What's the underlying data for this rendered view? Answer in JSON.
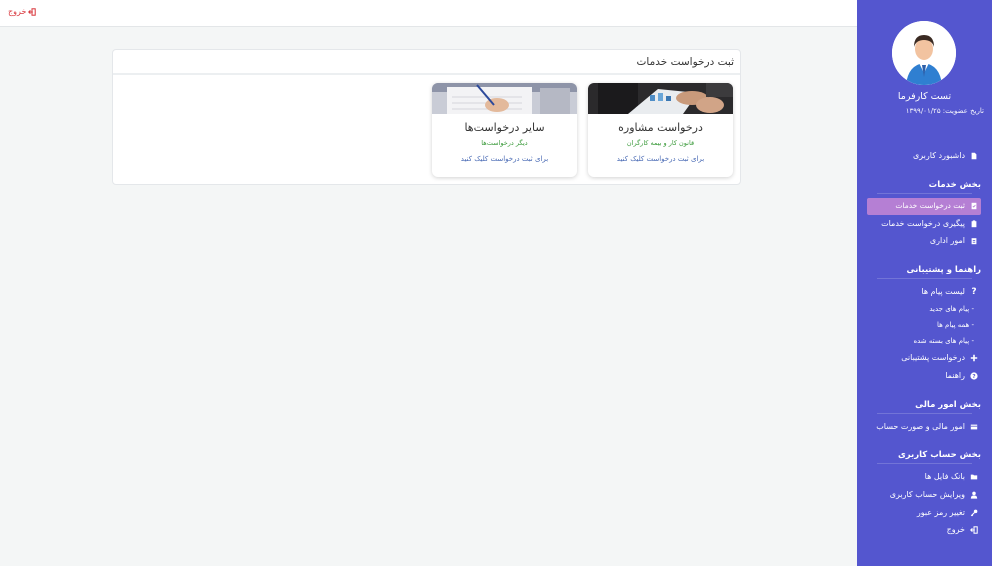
{
  "topbar": {
    "logout_label": "خروج"
  },
  "panel": {
    "title": "ثبت درخواست خدمات",
    "cards": [
      {
        "title": "درخواست مشاوره",
        "subtitle": "قانون کار و بیمه کارگران",
        "link": "برای ثبت درخواست کلیک کنید"
      },
      {
        "title": "سایر درخواست‌ها",
        "subtitle": "دیگر درخواست‌ها",
        "link": "برای ثبت درخواست کلیک کنید"
      }
    ]
  },
  "sidebar": {
    "user_name": "تست کارفرما",
    "join_date": "تاریخ عضویت: ۱۳۹۹/۰۱/۲۵",
    "dashboard": "داشبورد کاربری",
    "services": {
      "title": "بخش خدمات",
      "items": [
        "ثبت درخواست خدمات",
        "پیگیری درخواست خدمات",
        "امور اداری"
      ]
    },
    "support": {
      "title": "راهنما و پشتیبانی",
      "messages": "لیست پیام ها",
      "sub_items": [
        "- پیام های جدید",
        "- همه پیام ها",
        "- پیام های بسته شده"
      ],
      "support_request": "درخواست پشتیبانی",
      "help": "راهنما"
    },
    "finance": {
      "title": "بخش امور مالی",
      "items": [
        "امور مالی و صورت حساب"
      ]
    },
    "account": {
      "title": "بخش حساب کاربری",
      "items": [
        "بانک فایل ها",
        "ویرایش حساب کاربری",
        "تغییر رمز عبور",
        "خروج"
      ]
    }
  },
  "colors": {
    "sidebar_bg": "#5456cf",
    "active_item": "#b57fd4",
    "logout_red": "#d9393f",
    "card_subtitle_green": "#3a9a3a",
    "card_link_blue": "#4a6bb5"
  }
}
